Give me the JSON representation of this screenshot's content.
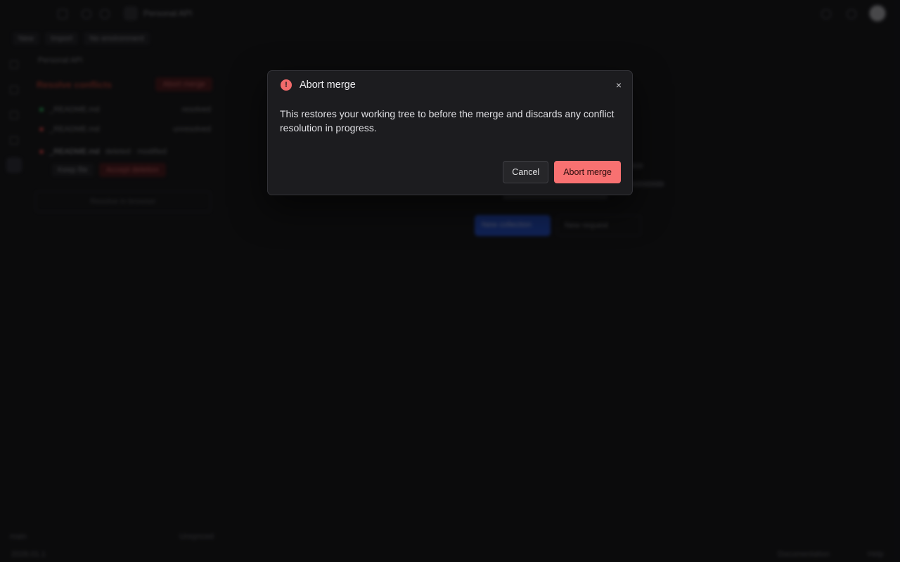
{
  "topbar": {
    "workspace_name": "Personal API"
  },
  "sidebar": {
    "toolbar": [
      "New",
      "Import",
      "No environment"
    ],
    "collection_name": "Personal API",
    "resolve_label": "Resolve conflicts",
    "abort_button": "Abort merge",
    "files": [
      {
        "name": "_README.md",
        "status": "resolved",
        "color": "#22c55e"
      },
      {
        "name": "_README.md",
        "status": "unresolved",
        "color": "#ef4444"
      },
      {
        "name": "_README.md",
        "status": "deleted · modified",
        "color": "#ef4444"
      }
    ],
    "keep_file": "Keep file",
    "accept_deletion": "Accept deletion",
    "box_label": "Resolve in browser",
    "footer_left": "main",
    "footer_right": "Unsynced",
    "version": "2026.01.1"
  },
  "main": {
    "new_collection": "New collection",
    "new_request": "New request"
  },
  "bottombar": {
    "docs": "Documentation",
    "help": "Help"
  },
  "modal": {
    "title": "Abort merge",
    "body": "This restores your working tree to before the merge and discards any conflict resolution in progress.",
    "close_icon": "×",
    "cancel_label": "Cancel",
    "confirm_label": "Abort merge",
    "colors": {
      "danger": "#f87171",
      "warning_icon": "#f26b6b",
      "surface": "#1c1c1f"
    }
  }
}
